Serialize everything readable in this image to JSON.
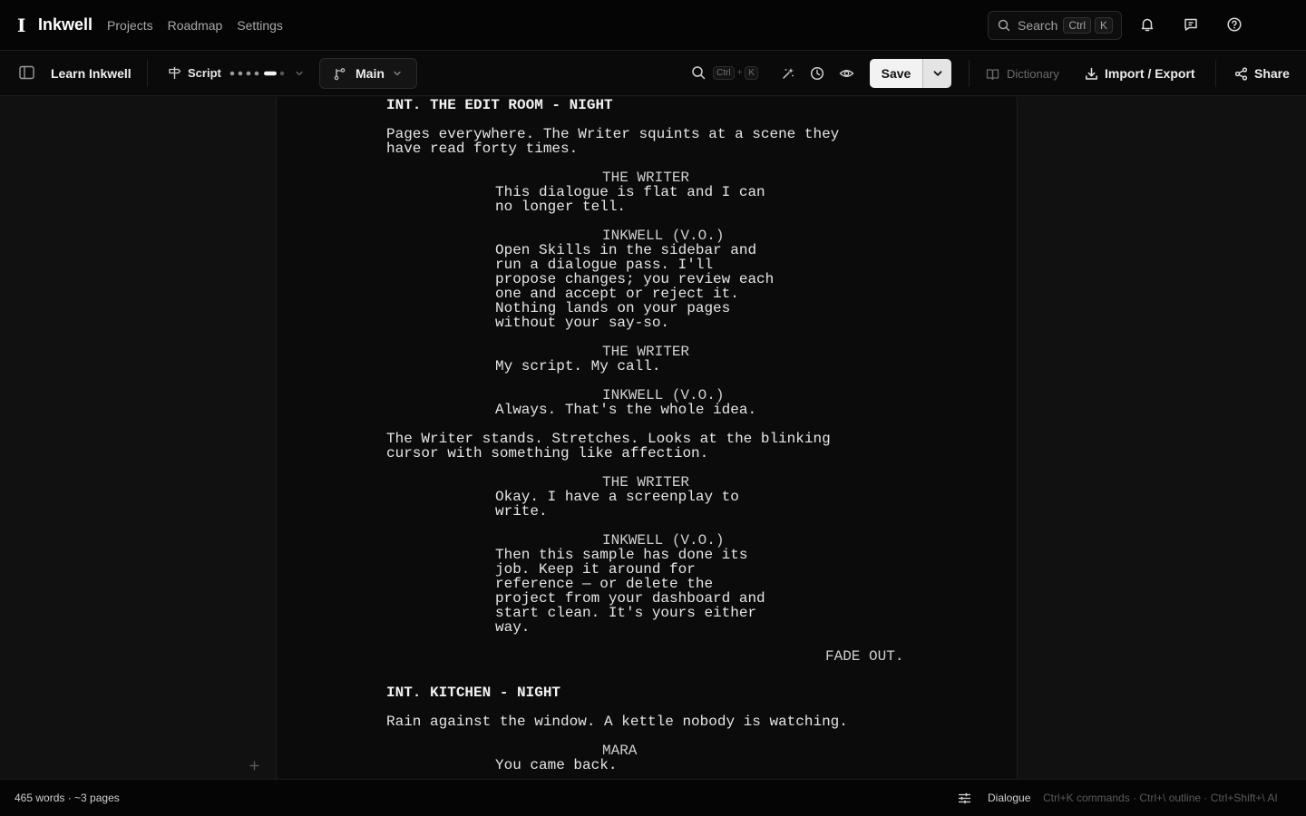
{
  "app": {
    "logo_mark": "I",
    "name": "Inkwell"
  },
  "nav": [
    "Projects",
    "Roadmap",
    "Settings"
  ],
  "search": {
    "label": "Search",
    "kbd1": "Ctrl",
    "kbd2": "K"
  },
  "toolbar": {
    "project_title": "Learn Inkwell",
    "script_label": "Script",
    "branch_label": "Main",
    "find_kbd1": "Ctrl",
    "find_plus": "+",
    "find_kbd2": "K",
    "save_label": "Save",
    "dictionary_label": "Dictionary",
    "import_export_label": "Import / Export",
    "share_label": "Share"
  },
  "script": [
    {
      "type": "scene",
      "text": "INT. THE EDIT ROOM - NIGHT"
    },
    {
      "type": "action",
      "text": "Pages everywhere. The Writer squints at a scene they\nhave read forty times."
    },
    {
      "type": "character",
      "text": "THE WRITER"
    },
    {
      "type": "dialogue",
      "text": "This dialogue is flat and I can\nno longer tell."
    },
    {
      "type": "character",
      "text": "INKWELL (V.O.)"
    },
    {
      "type": "dialogue",
      "text": "Open Skills in the sidebar and\nrun a dialogue pass. I'll\npropose changes; you review each\none and accept or reject it.\nNothing lands on your pages\nwithout your say-so."
    },
    {
      "type": "character",
      "text": "THE WRITER"
    },
    {
      "type": "dialogue",
      "text": "My script. My call."
    },
    {
      "type": "character",
      "text": "INKWELL (V.O.)"
    },
    {
      "type": "dialogue",
      "text": "Always. That's the whole idea."
    },
    {
      "type": "action",
      "text": "The Writer stands. Stretches. Looks at the blinking\ncursor with something like affection."
    },
    {
      "type": "character",
      "text": "THE WRITER"
    },
    {
      "type": "dialogue",
      "text": "Okay. I have a screenplay to\nwrite."
    },
    {
      "type": "character",
      "text": "INKWELL (V.O.)"
    },
    {
      "type": "dialogue",
      "text": "Then this sample has done its\njob. Keep it around for\nreference — or delete the\nproject from your dashboard and\nstart clean. It's yours either\nway."
    },
    {
      "type": "transition",
      "text": "FADE OUT."
    },
    {
      "type": "scene",
      "text": "INT. KITCHEN - NIGHT"
    },
    {
      "type": "action",
      "text": "Rain against the window. A kettle nobody is watching."
    },
    {
      "type": "character",
      "text": "MARA"
    },
    {
      "type": "dialogue",
      "text": "You came back."
    }
  ],
  "status": {
    "counts": "465 words · ~3 pages",
    "mode": "Dialogue",
    "hints": "Ctrl+K commands · Ctrl+\\ outline · Ctrl+Shift+\\ AI"
  },
  "colors": {
    "background": "#0f0f0f",
    "accent": "#f2f2f2",
    "muted": "#a8a8a8"
  }
}
